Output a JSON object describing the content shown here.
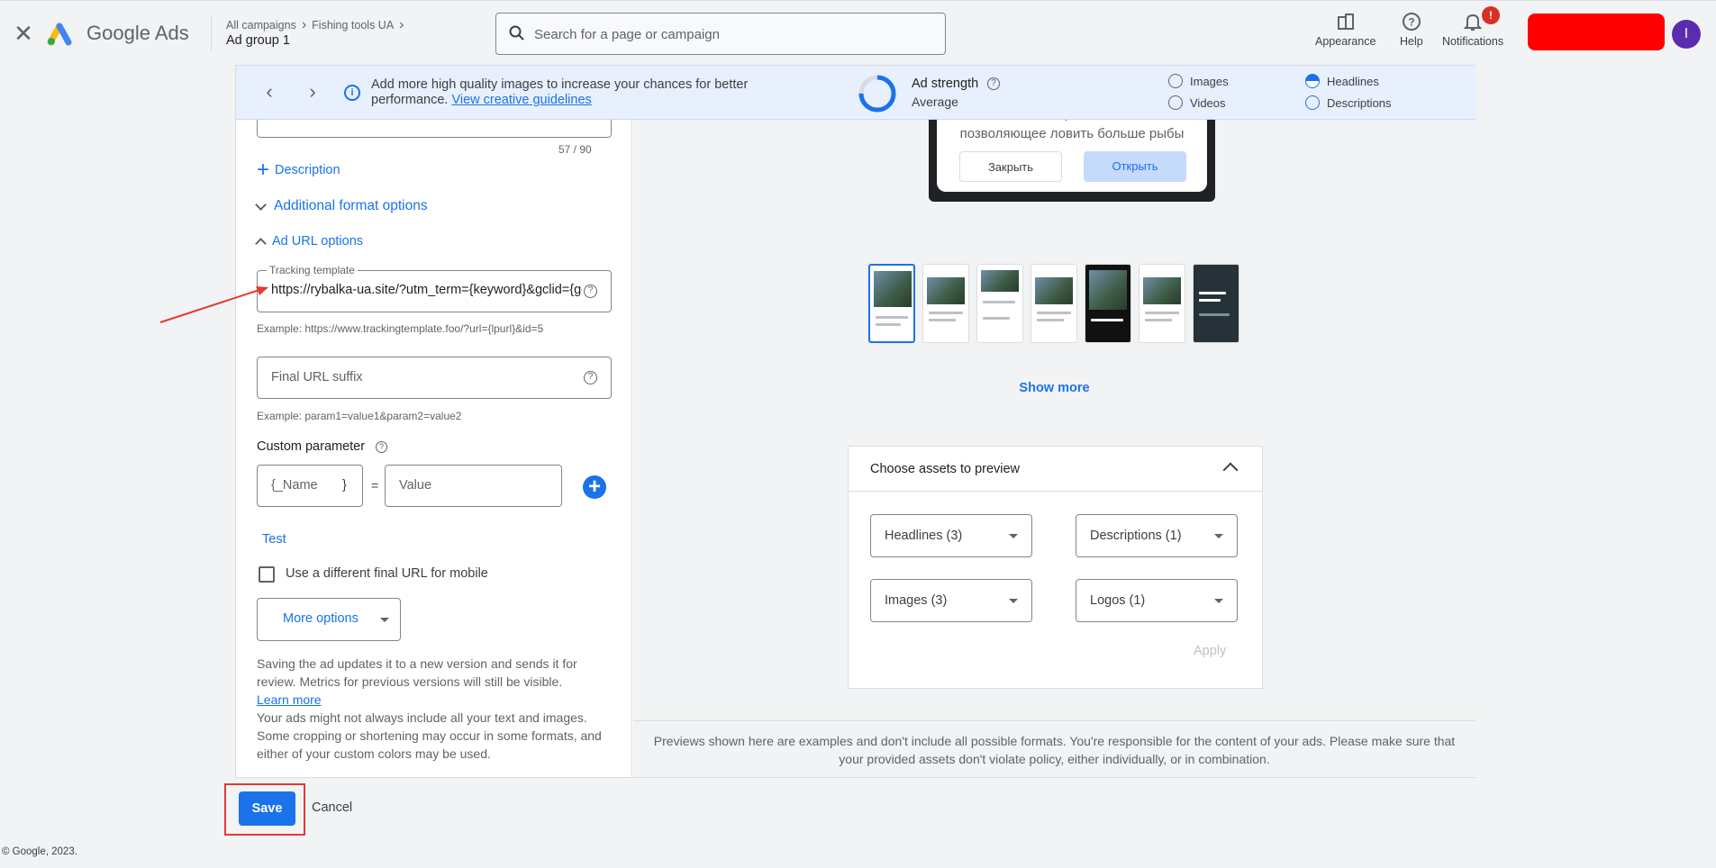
{
  "header": {
    "brand": "Google Ads",
    "breadcrumb": [
      "All campaigns",
      "Fishing tools UA"
    ],
    "current_page": "Ad group 1",
    "search_placeholder": "Search for a page or campaign",
    "tools": [
      {
        "label": "Appearance",
        "icon": "appearance-icon"
      },
      {
        "label": "Help",
        "icon": "help-icon"
      },
      {
        "label": "Notifications",
        "icon": "bell-icon"
      }
    ],
    "notification_badge": "!",
    "avatar_initial": "I",
    "redaction_color": "#ff0000"
  },
  "infobar": {
    "message": "Add more high quality images to increase your chances for better performance.",
    "link": "View creative guidelines",
    "ad_strength_label": "Ad strength",
    "ad_strength_value": "Average",
    "ad_strength_fraction": 0.75,
    "checklist": [
      "Images",
      "Videos",
      "Headlines",
      "Descriptions"
    ]
  },
  "form": {
    "char_counter": "57 / 90",
    "description_link": "Description",
    "additional_formats": "Additional format options",
    "url_options": "Ad URL options",
    "tracking_label": "Tracking template",
    "tracking_value": "https://rybalka-ua.site/?utm_term={keyword}&gclid={gc",
    "tracking_example": "Example: https://www.trackingtemplate.foo/?url={lpurl}&id=5",
    "final_url_suffix_placeholder": "Final URL suffix",
    "final_url_example": "Example: param1=value1&param2=value2",
    "custom_param_title": "Custom parameter",
    "param_name_placeholder": "{_Name",
    "param_brace": "}",
    "param_equals": "=",
    "param_value_placeholder": "Value",
    "test_link": "Test",
    "mobile_checkbox": "Use a different final URL for mobile",
    "more_options": "More options",
    "notice_1": "Saving the ad updates it to a new version and sends it for review. Metrics for previous versions will still be visible.",
    "learn_more": "Learn more",
    "notice_2": "Your ads might not always include all your text and images. Some cropping or shortening may occur in some formats, and either of your custom colors may be used."
  },
  "preview": {
    "ad_text": "Уникальное приспособление, позволяющее ловить больше рыбы",
    "close_btn": "Закрыть",
    "open_btn": "Открыть",
    "show_more": "Show more",
    "assets_title": "Choose assets to preview",
    "dropdowns": [
      "Headlines (3)",
      "Descriptions (1)",
      "Images (3)",
      "Logos (1)"
    ],
    "apply": "Apply",
    "disclaimer": "Previews shown here are examples and don't include all possible formats. You're responsible for the content of your ads. Please make sure that your provided assets don't violate policy, either individually, or in combination."
  },
  "actions": {
    "save": "Save",
    "cancel": "Cancel"
  },
  "footer": "© Google, 2023.",
  "colors": {
    "accent": "#1a73e8",
    "annotation": "#e53935"
  }
}
